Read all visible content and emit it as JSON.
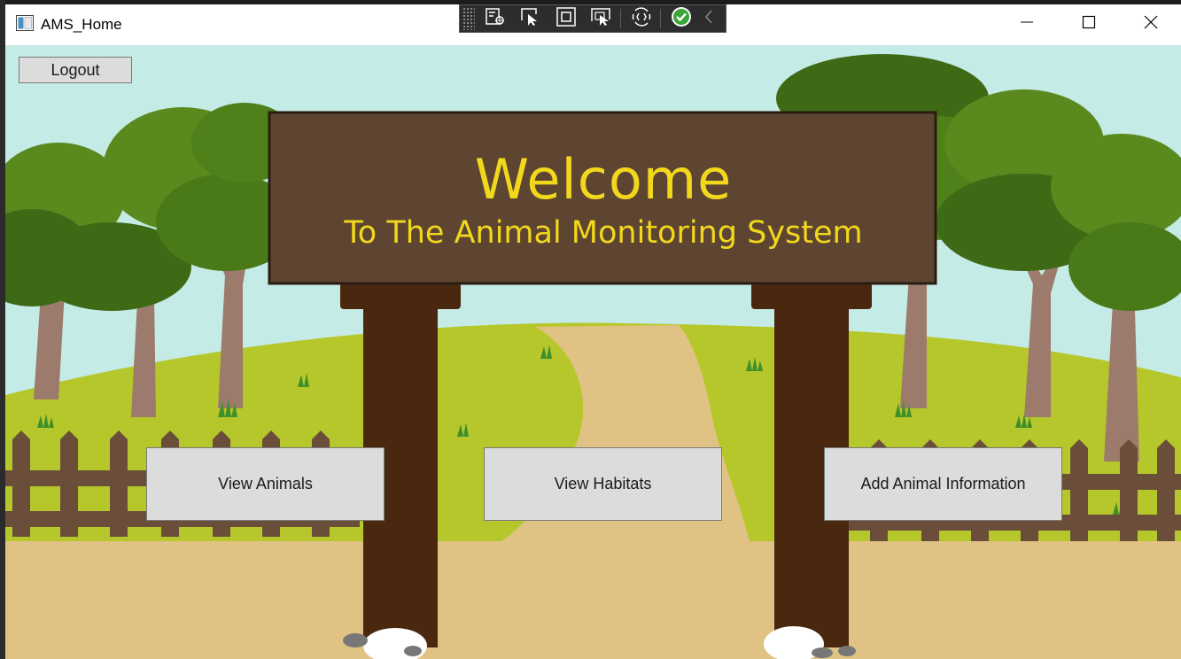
{
  "window": {
    "title": "AMS_Home",
    "controls": {
      "minimize_icon": "minimize-icon",
      "maximize_icon": "maximize-icon",
      "close_icon": "close-icon"
    }
  },
  "debug_toolbar": {
    "icons": [
      "live-visual-tree-icon",
      "select-element-icon",
      "display-layout-adorners-icon",
      "track-focused-element-icon",
      "hot-reload-icon",
      "binding-ok-icon",
      "collapse-chevron-icon"
    ]
  },
  "header": {
    "logout_label": "Logout"
  },
  "sign": {
    "title": "Welcome",
    "subtitle": "To The Animal Monitoring System"
  },
  "actions": {
    "view_animals": "View Animals",
    "view_habitats": "View Habitats",
    "add_animal_info": "Add Animal Information"
  },
  "colors": {
    "sky": "#c5ebe6",
    "hill": "#b5c72a",
    "path": "#e0c384",
    "sign_board": "#5e4532",
    "sign_text": "#f2d81b",
    "post": "#4a2810",
    "fence": "#6b4e3a",
    "button_bg": "#dcdcdc"
  }
}
